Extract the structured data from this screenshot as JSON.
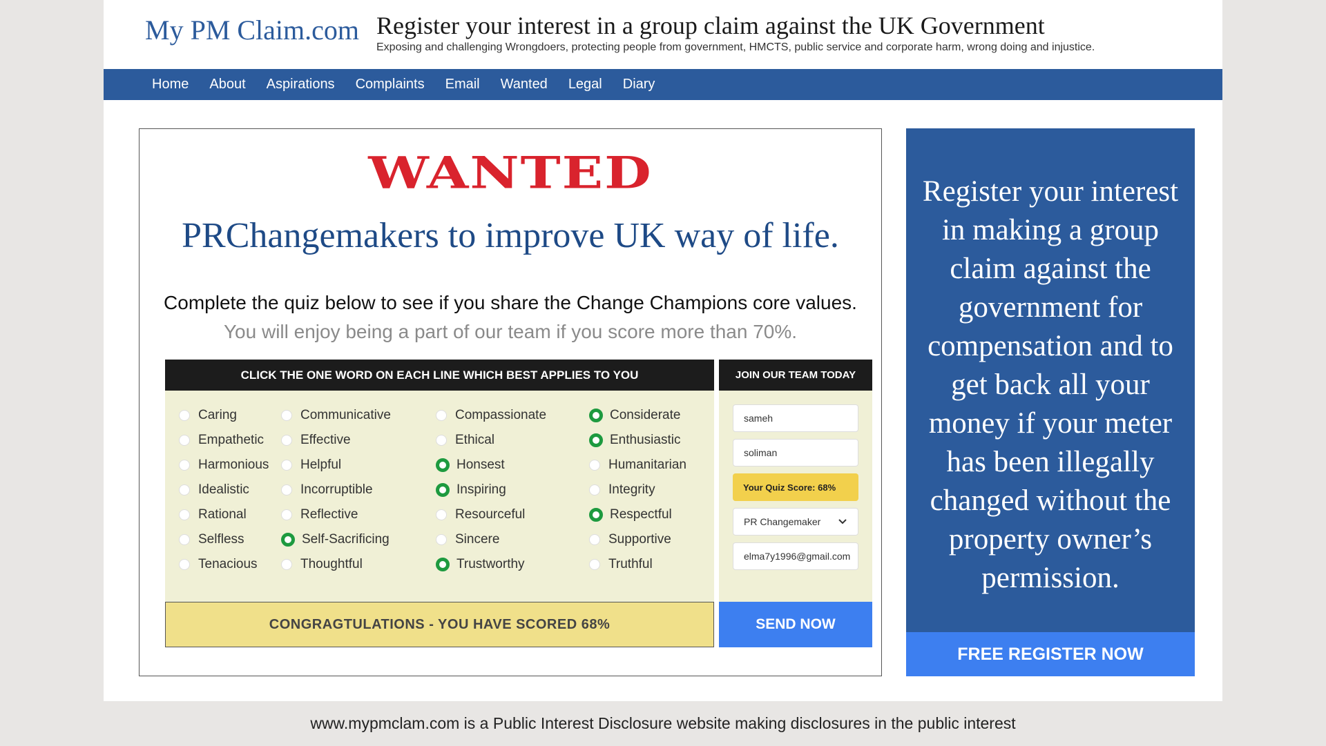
{
  "header": {
    "site_title": "My PM Claim.com",
    "headline": "Register your interest in a group claim against the UK Government",
    "tagline": "Exposing and challenging Wrongdoers, protecting people from government, HMCTS, public service and corporate harm, wrong doing and injustice."
  },
  "nav": [
    "Home",
    "About",
    "Aspirations",
    "Complaints",
    "Email",
    "Wanted",
    "Legal",
    "Diary"
  ],
  "main": {
    "wanted_title": "WANTED",
    "subtitle": "PRChangemakers to improve UK way of life.",
    "intro_line1": "Complete the quiz below to see if you share the Change Champions core values.",
    "intro_line2": "You will enjoy being a part of our team if you score more than 70%.",
    "quiz_header": "CLICK THE ONE WORD ON EACH LINE WHICH BEST APPLIES TO YOU",
    "quiz_rows": [
      {
        "options": [
          "Caring",
          "Communicative",
          "Compassionate",
          "Considerate"
        ],
        "selected": 3
      },
      {
        "options": [
          "Empathetic",
          "Effective",
          "Ethical",
          "Enthusiastic"
        ],
        "selected": 3
      },
      {
        "options": [
          "Harmonious",
          "Helpful",
          "Honsest",
          "Humanitarian"
        ],
        "selected": 2
      },
      {
        "options": [
          "Idealistic",
          "Incorruptible",
          "Inspiring",
          "Integrity"
        ],
        "selected": 2
      },
      {
        "options": [
          "Rational",
          "Reflective",
          "Resourceful",
          "Respectful"
        ],
        "selected": 3
      },
      {
        "options": [
          "Selfless",
          "Self-Sacrificing",
          "Sincere",
          "Supportive"
        ],
        "selected": 1
      },
      {
        "options": [
          "Tenacious",
          "Thoughtful",
          "Trustworthy",
          "Truthful"
        ],
        "selected": 2
      }
    ],
    "score_banner": "CONGRAGTULATIONS - YOU HAVE SCORED 68%"
  },
  "join": {
    "header": "JOIN OUR TEAM TODAY",
    "first_name": "sameh",
    "last_name": "soliman",
    "quiz_score": "Your Quiz Score: 68%",
    "role_select": "PR Changemaker",
    "email": "elma7y1996@gmail.com",
    "send_button": "SEND NOW"
  },
  "promo": {
    "text": "Register your interest in making a group claim against the government for compensation and to get back all your money if your meter has been illegally changed without the property owner’s permission.",
    "button": "FREE REGISTER NOW"
  },
  "footer": {
    "text": "www.mypmclam.com is a Public Interest Disclosure website making disclosures in the public interest"
  },
  "colors": {
    "brand_blue": "#2c5b9c",
    "button_blue": "#3d7ff0",
    "wanted_red": "#d9232d",
    "quiz_bg": "#f0f0d6",
    "score_yellow": "#f2d04c",
    "radio_green": "#1d9a3f"
  }
}
